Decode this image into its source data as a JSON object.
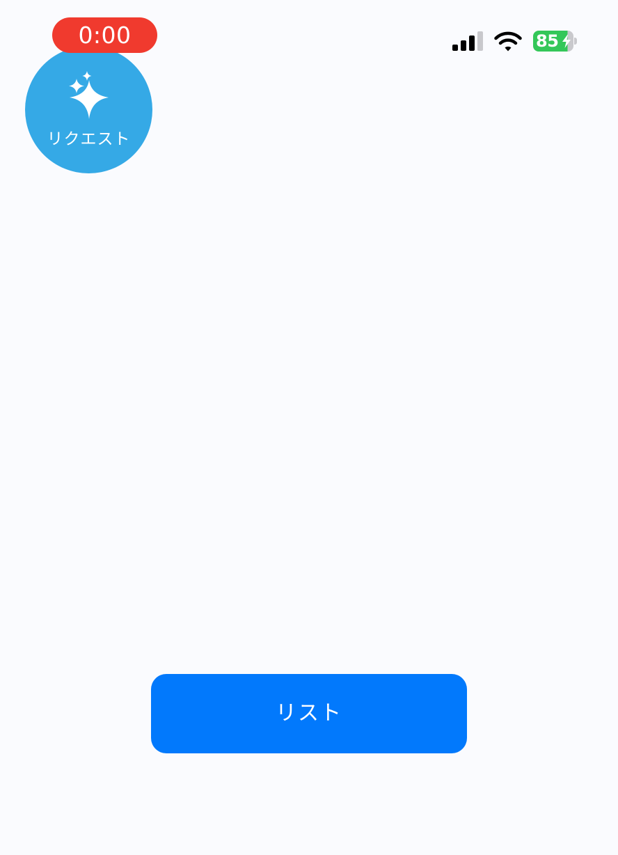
{
  "status_bar": {
    "timer": "0:00",
    "battery_level": "85",
    "signal_icon": "cellular-signal-icon",
    "wifi_icon": "wifi-icon",
    "charging_icon": "charging-bolt-icon",
    "timer_color": "#f03a2e",
    "battery_color": "#34c759"
  },
  "request_bubble": {
    "label": "リクエスト",
    "icon": "sparkles-icon",
    "color": "#35a9e6"
  },
  "main": {
    "list_button_label": "リスト",
    "accent": "#0279fc"
  }
}
